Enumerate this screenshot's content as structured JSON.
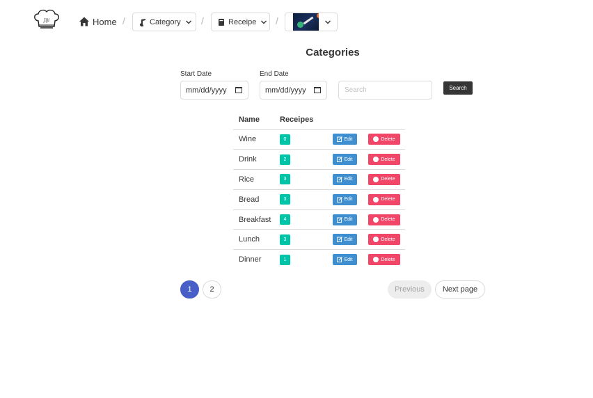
{
  "nav": {
    "home_label": "Home",
    "separator": "/",
    "category_label": "Category",
    "receipe_label": "Receipe",
    "logo_icon": "chef-hat-icon",
    "home_icon": "home-icon",
    "category_icon": "music-note-icon",
    "receipe_icon": "book-icon",
    "user_image_icon": "space-rocket-image"
  },
  "page": {
    "title": "Categories"
  },
  "filters": {
    "start_date_label": "Start Date",
    "start_date_value": "mm/dd/yyyy",
    "end_date_label": "End Date",
    "end_date_value": "mm/dd/yyyy",
    "search_placeholder": "Search",
    "search_button": "Search"
  },
  "table": {
    "headers": [
      "Name",
      "Receipes"
    ],
    "edit_label": "Edit",
    "delete_label": "Delete",
    "rows": [
      {
        "name": "Wine",
        "count": "0"
      },
      {
        "name": "Drink",
        "count": "2"
      },
      {
        "name": "Rice",
        "count": "3"
      },
      {
        "name": "Bread",
        "count": "3"
      },
      {
        "name": "Breakfast",
        "count": "4"
      },
      {
        "name": "Lunch",
        "count": "3"
      },
      {
        "name": "Dinner",
        "count": "1"
      }
    ]
  },
  "pagination": {
    "pages": [
      "1",
      "2"
    ],
    "current": "1",
    "previous_label": "Previous",
    "next_label": "Next page"
  },
  "colors": {
    "primary": "#485fc7",
    "info": "#3e8ed0",
    "danger": "#f14668",
    "success": "#00c4a7",
    "dark": "#363636"
  }
}
